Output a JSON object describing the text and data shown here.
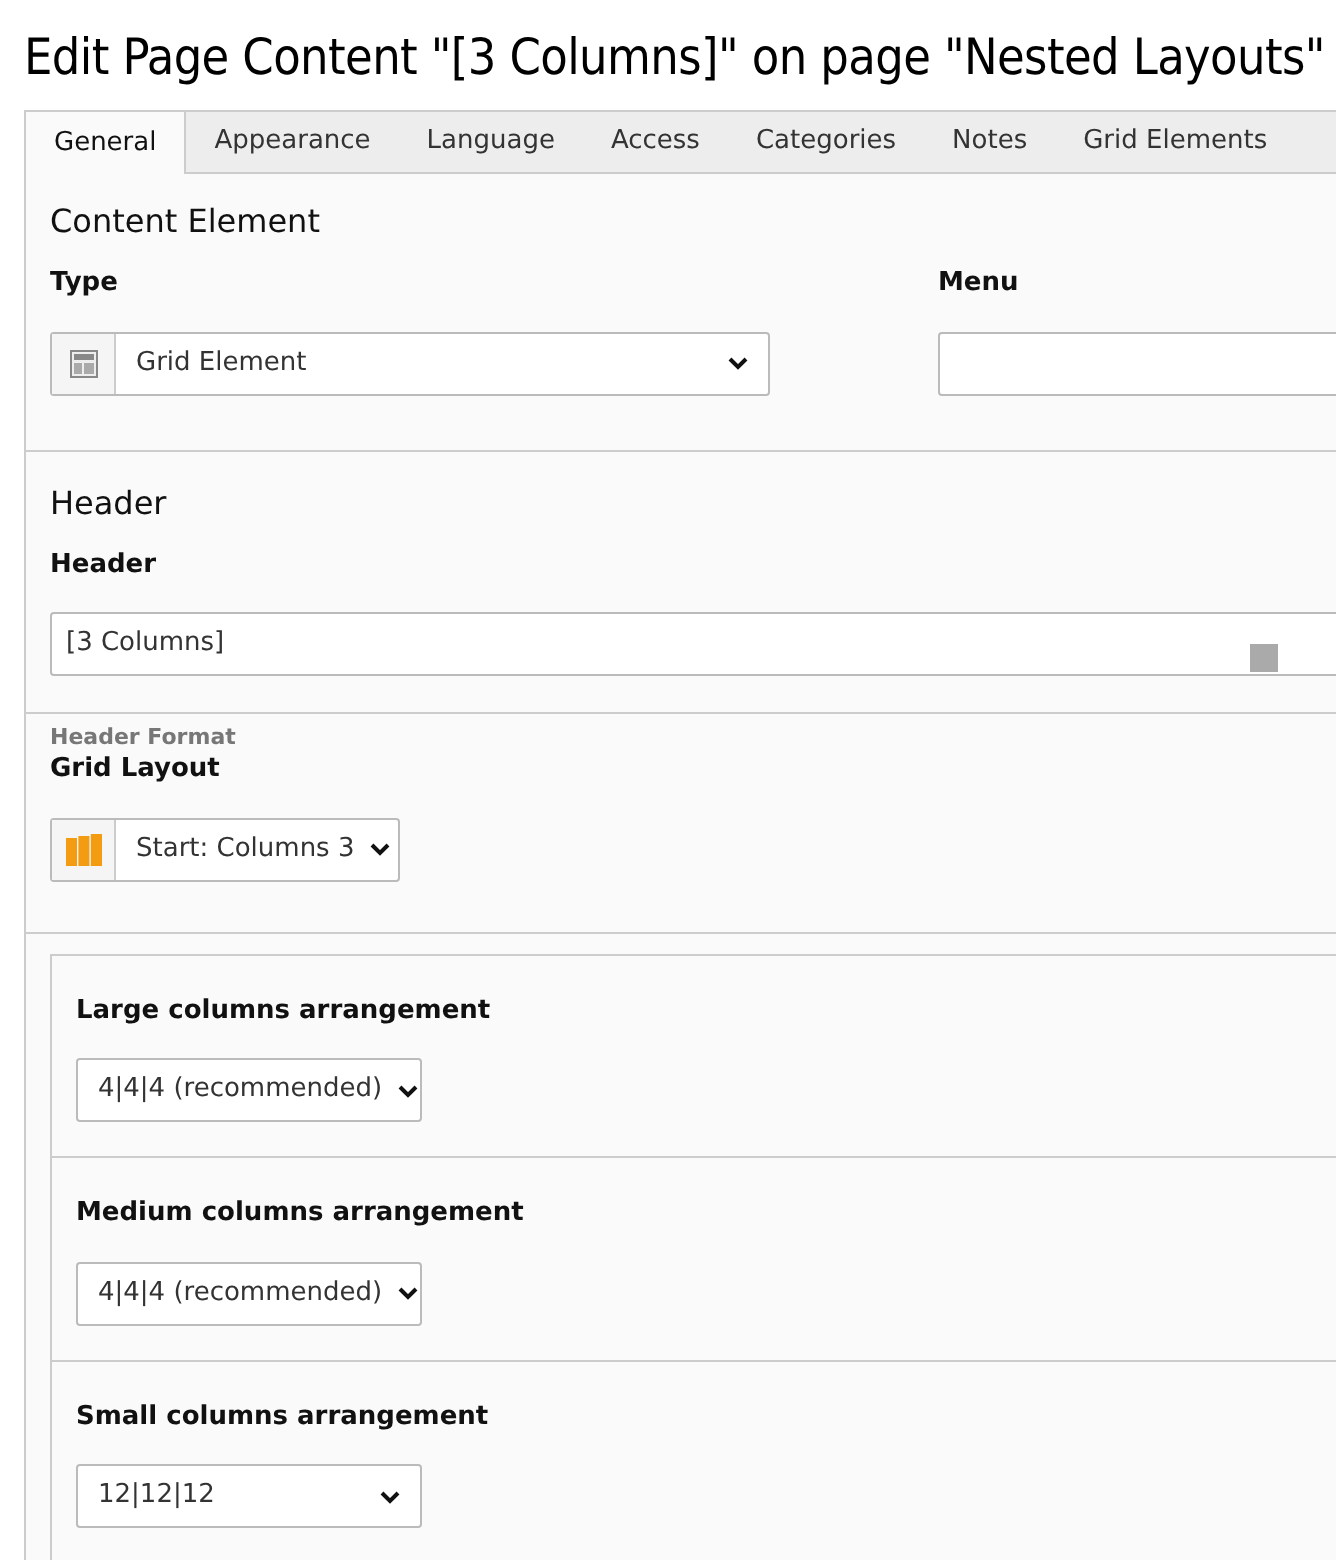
{
  "title": "Edit Page Content \"[3 Columns]\" on page \"Nested Layouts\"",
  "tabs": [
    {
      "label": "General",
      "selected": true
    },
    {
      "label": "Appearance",
      "selected": false
    },
    {
      "label": "Language",
      "selected": false
    },
    {
      "label": "Access",
      "selected": false
    },
    {
      "label": "Categories",
      "selected": false
    },
    {
      "label": "Notes",
      "selected": false
    },
    {
      "label": "Grid Elements",
      "selected": false
    }
  ],
  "content_element": {
    "heading": "Content Element",
    "type_label": "Type",
    "type_value": "Grid Element",
    "menu_label": "Menu"
  },
  "header_section": {
    "heading": "Header",
    "header_label": "Header",
    "header_value": "[3 Columns]",
    "header_format_label": "Header Format"
  },
  "grid_layout": {
    "label": "Grid Layout",
    "value": "Start: Columns 3"
  },
  "arrangements": [
    {
      "label": "Large columns arrangement",
      "value": "4|4|4 (recommended)"
    },
    {
      "label": "Medium columns arrangement",
      "value": "4|4|4 (recommended)"
    },
    {
      "label": "Small columns arrangement",
      "value": "12|12|12"
    }
  ]
}
